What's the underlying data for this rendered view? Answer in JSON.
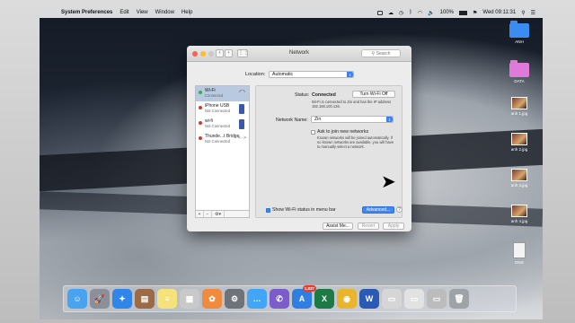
{
  "menubar": {
    "app": "System Preferences",
    "items": [
      "Edit",
      "View",
      "Window",
      "Help"
    ],
    "battery": "100%",
    "datetime": "Wed 09:11:31"
  },
  "desktop": {
    "icons": [
      {
        "label": "ANH",
        "kind": "folder",
        "color": "#3b8cf0"
      },
      {
        "label": "DATA",
        "kind": "folder",
        "color": "#e07ad9"
      },
      {
        "label": "anh 1.jpg",
        "kind": "image"
      },
      {
        "label": "anh 2.jpg",
        "kind": "image"
      },
      {
        "label": "anh 3.jpg",
        "kind": "image"
      },
      {
        "label": "anh 4.jpg",
        "kind": "image"
      },
      {
        "label": "DNS",
        "kind": "document"
      }
    ]
  },
  "window": {
    "title": "Network",
    "search_placeholder": "Search",
    "location_label": "Location:",
    "location_value": "Automatic",
    "services": [
      {
        "name": "Wi-Fi",
        "status": "Connected",
        "dot": "#2fb24a",
        "selected": true
      },
      {
        "name": "iPhone USB",
        "status": "Not Connected",
        "dot": "#d33a2f"
      },
      {
        "name": "wi-fi",
        "status": "Not Connected",
        "dot": "#d33a2f"
      },
      {
        "name": "Thunde...t Bridge",
        "status": "Not Connected",
        "dot": "#d33a2f"
      }
    ],
    "footer": {
      "add": "+",
      "remove": "−",
      "gear": "⚙▾"
    },
    "detail": {
      "status_label": "Status:",
      "status_value": "Connected",
      "turn_off": "Turn Wi-Fi Off",
      "status_desc": "Wi-Fi is connected to Zin and has the IP address 192.168.100.136.",
      "network_name_label": "Network Name:",
      "network_name": "Zin",
      "ask_join_label": "Ask to join new networks",
      "ask_join_desc": "Known networks will be joined automatically. If no known networks are available, you will have to manually select a network.",
      "show_status_label": "Show Wi-Fi status in menu bar",
      "advanced": "Advanced...",
      "help": "?"
    },
    "buttons": {
      "assist": "Assist Me...",
      "revert": "Revert",
      "apply": "Apply"
    }
  },
  "dock": {
    "apps": [
      {
        "name": "finder",
        "glyph": "☺",
        "color": "#4aa3f0"
      },
      {
        "name": "launchpad",
        "glyph": "🚀",
        "color": "#8a8f99"
      },
      {
        "name": "safari",
        "glyph": "✦",
        "color": "#2f86e8"
      },
      {
        "name": "contacts",
        "glyph": "▤",
        "color": "#9c6a44"
      },
      {
        "name": "notes",
        "glyph": "≡",
        "color": "#f5e27a"
      },
      {
        "name": "preview",
        "glyph": "▦",
        "color": "#c9c9c9"
      },
      {
        "name": "photos",
        "glyph": "✿",
        "color": "#f08a3c"
      },
      {
        "name": "system-preferences",
        "glyph": "⚙",
        "color": "#6e737a"
      },
      {
        "name": "messages",
        "glyph": "…",
        "color": "#42a5f5"
      },
      {
        "name": "viber",
        "glyph": "✆",
        "color": "#7b5cc9"
      },
      {
        "name": "app-store",
        "glyph": "A",
        "color": "#2f7fe0",
        "badge": "1,837"
      },
      {
        "name": "excel",
        "glyph": "X",
        "color": "#1e7a45"
      },
      {
        "name": "chrome",
        "glyph": "◉",
        "color": "#e9b52c"
      },
      {
        "name": "word",
        "glyph": "W",
        "color": "#2a5ab4"
      },
      {
        "name": "folder-stack",
        "glyph": "▭",
        "color": "#d6d6d6"
      },
      {
        "name": "documents",
        "glyph": "▭",
        "color": "#e2e2e2"
      },
      {
        "name": "downloads",
        "glyph": "▭",
        "color": "#bcbcbc"
      },
      {
        "name": "trash",
        "glyph": "🗑",
        "color": "#9ea3a8"
      }
    ]
  }
}
